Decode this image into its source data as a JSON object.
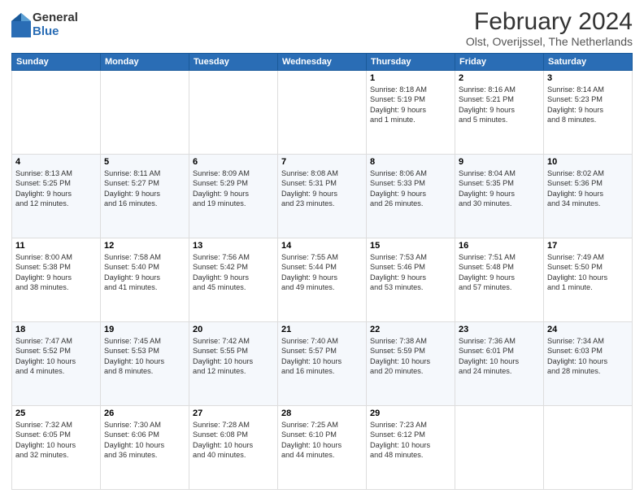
{
  "logo": {
    "general": "General",
    "blue": "Blue"
  },
  "title": "February 2024",
  "subtitle": "Olst, Overijssel, The Netherlands",
  "headers": [
    "Sunday",
    "Monday",
    "Tuesday",
    "Wednesday",
    "Thursday",
    "Friday",
    "Saturday"
  ],
  "weeks": [
    [
      {
        "day": "",
        "info": ""
      },
      {
        "day": "",
        "info": ""
      },
      {
        "day": "",
        "info": ""
      },
      {
        "day": "",
        "info": ""
      },
      {
        "day": "1",
        "info": "Sunrise: 8:18 AM\nSunset: 5:19 PM\nDaylight: 9 hours\nand 1 minute."
      },
      {
        "day": "2",
        "info": "Sunrise: 8:16 AM\nSunset: 5:21 PM\nDaylight: 9 hours\nand 5 minutes."
      },
      {
        "day": "3",
        "info": "Sunrise: 8:14 AM\nSunset: 5:23 PM\nDaylight: 9 hours\nand 8 minutes."
      }
    ],
    [
      {
        "day": "4",
        "info": "Sunrise: 8:13 AM\nSunset: 5:25 PM\nDaylight: 9 hours\nand 12 minutes."
      },
      {
        "day": "5",
        "info": "Sunrise: 8:11 AM\nSunset: 5:27 PM\nDaylight: 9 hours\nand 16 minutes."
      },
      {
        "day": "6",
        "info": "Sunrise: 8:09 AM\nSunset: 5:29 PM\nDaylight: 9 hours\nand 19 minutes."
      },
      {
        "day": "7",
        "info": "Sunrise: 8:08 AM\nSunset: 5:31 PM\nDaylight: 9 hours\nand 23 minutes."
      },
      {
        "day": "8",
        "info": "Sunrise: 8:06 AM\nSunset: 5:33 PM\nDaylight: 9 hours\nand 26 minutes."
      },
      {
        "day": "9",
        "info": "Sunrise: 8:04 AM\nSunset: 5:35 PM\nDaylight: 9 hours\nand 30 minutes."
      },
      {
        "day": "10",
        "info": "Sunrise: 8:02 AM\nSunset: 5:36 PM\nDaylight: 9 hours\nand 34 minutes."
      }
    ],
    [
      {
        "day": "11",
        "info": "Sunrise: 8:00 AM\nSunset: 5:38 PM\nDaylight: 9 hours\nand 38 minutes."
      },
      {
        "day": "12",
        "info": "Sunrise: 7:58 AM\nSunset: 5:40 PM\nDaylight: 9 hours\nand 41 minutes."
      },
      {
        "day": "13",
        "info": "Sunrise: 7:56 AM\nSunset: 5:42 PM\nDaylight: 9 hours\nand 45 minutes."
      },
      {
        "day": "14",
        "info": "Sunrise: 7:55 AM\nSunset: 5:44 PM\nDaylight: 9 hours\nand 49 minutes."
      },
      {
        "day": "15",
        "info": "Sunrise: 7:53 AM\nSunset: 5:46 PM\nDaylight: 9 hours\nand 53 minutes."
      },
      {
        "day": "16",
        "info": "Sunrise: 7:51 AM\nSunset: 5:48 PM\nDaylight: 9 hours\nand 57 minutes."
      },
      {
        "day": "17",
        "info": "Sunrise: 7:49 AM\nSunset: 5:50 PM\nDaylight: 10 hours\nand 1 minute."
      }
    ],
    [
      {
        "day": "18",
        "info": "Sunrise: 7:47 AM\nSunset: 5:52 PM\nDaylight: 10 hours\nand 4 minutes."
      },
      {
        "day": "19",
        "info": "Sunrise: 7:45 AM\nSunset: 5:53 PM\nDaylight: 10 hours\nand 8 minutes."
      },
      {
        "day": "20",
        "info": "Sunrise: 7:42 AM\nSunset: 5:55 PM\nDaylight: 10 hours\nand 12 minutes."
      },
      {
        "day": "21",
        "info": "Sunrise: 7:40 AM\nSunset: 5:57 PM\nDaylight: 10 hours\nand 16 minutes."
      },
      {
        "day": "22",
        "info": "Sunrise: 7:38 AM\nSunset: 5:59 PM\nDaylight: 10 hours\nand 20 minutes."
      },
      {
        "day": "23",
        "info": "Sunrise: 7:36 AM\nSunset: 6:01 PM\nDaylight: 10 hours\nand 24 minutes."
      },
      {
        "day": "24",
        "info": "Sunrise: 7:34 AM\nSunset: 6:03 PM\nDaylight: 10 hours\nand 28 minutes."
      }
    ],
    [
      {
        "day": "25",
        "info": "Sunrise: 7:32 AM\nSunset: 6:05 PM\nDaylight: 10 hours\nand 32 minutes."
      },
      {
        "day": "26",
        "info": "Sunrise: 7:30 AM\nSunset: 6:06 PM\nDaylight: 10 hours\nand 36 minutes."
      },
      {
        "day": "27",
        "info": "Sunrise: 7:28 AM\nSunset: 6:08 PM\nDaylight: 10 hours\nand 40 minutes."
      },
      {
        "day": "28",
        "info": "Sunrise: 7:25 AM\nSunset: 6:10 PM\nDaylight: 10 hours\nand 44 minutes."
      },
      {
        "day": "29",
        "info": "Sunrise: 7:23 AM\nSunset: 6:12 PM\nDaylight: 10 hours\nand 48 minutes."
      },
      {
        "day": "",
        "info": ""
      },
      {
        "day": "",
        "info": ""
      }
    ]
  ]
}
